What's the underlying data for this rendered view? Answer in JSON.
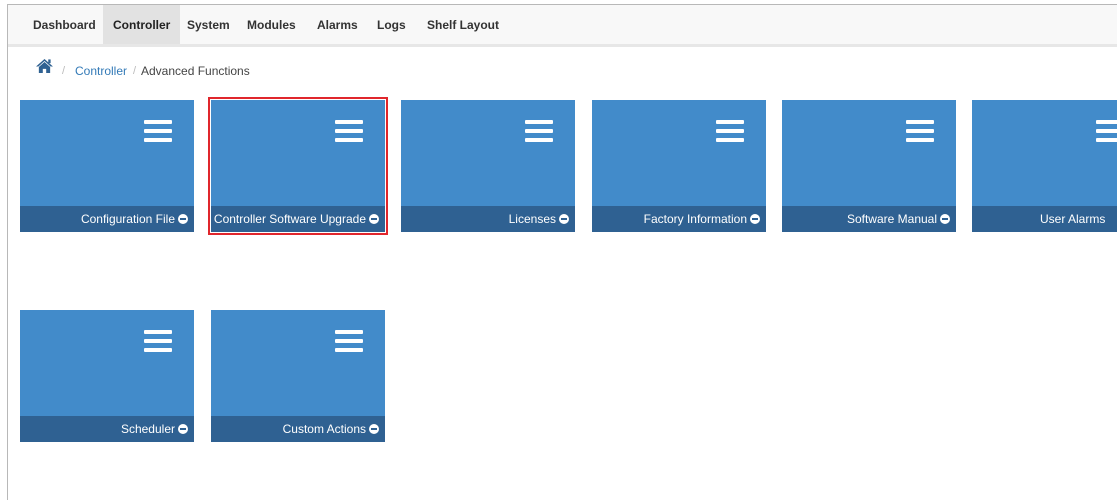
{
  "nav": {
    "items": [
      {
        "label": "Dashboard",
        "active": false
      },
      {
        "label": "Controller",
        "active": true
      },
      {
        "label": "System",
        "active": false
      },
      {
        "label": "Modules",
        "active": false
      },
      {
        "label": "Alarms",
        "active": false
      },
      {
        "label": "Logs",
        "active": false
      },
      {
        "label": "Shelf Layout",
        "active": false
      }
    ]
  },
  "breadcrumb": {
    "home_icon": "home-icon",
    "separator": "/",
    "items": [
      {
        "label": "Controller",
        "link": true
      },
      {
        "label": "Advanced Functions",
        "link": false
      }
    ]
  },
  "tiles": [
    {
      "label": "Configuration File",
      "icon": "menu-icon",
      "selected": false
    },
    {
      "label": "Controller Software Upgrade",
      "icon": "menu-icon",
      "selected": true
    },
    {
      "label": "Licenses",
      "icon": "menu-icon",
      "selected": false
    },
    {
      "label": "Factory Information",
      "icon": "menu-icon",
      "selected": false
    },
    {
      "label": "Software Manual",
      "icon": "menu-icon",
      "selected": false
    },
    {
      "label": "User Alarms",
      "icon": "menu-icon",
      "selected": false
    },
    {
      "label": "Scheduler",
      "icon": "menu-icon",
      "selected": false
    },
    {
      "label": "Custom Actions",
      "icon": "menu-icon",
      "selected": false
    }
  ],
  "colors": {
    "tile_body": "#428bca",
    "tile_footer": "#2f6192",
    "selection_outline": "#e0262c",
    "link": "#337ab7"
  }
}
